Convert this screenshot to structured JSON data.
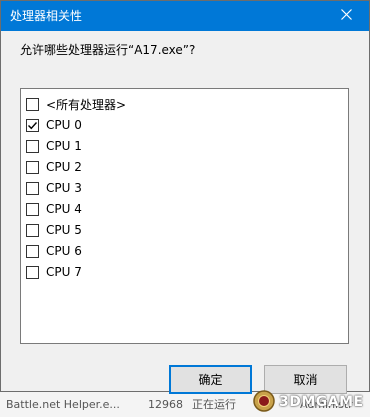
{
  "dialog": {
    "title": "处理器相关性",
    "prompt": "允许哪些处理器运行“A17.exe”?",
    "items": [
      {
        "label": "<所有处理器>",
        "checked": false
      },
      {
        "label": "CPU 0",
        "checked": true
      },
      {
        "label": "CPU 1",
        "checked": false
      },
      {
        "label": "CPU 2",
        "checked": false
      },
      {
        "label": "CPU 3",
        "checked": false
      },
      {
        "label": "CPU 4",
        "checked": false
      },
      {
        "label": "CPU 5",
        "checked": false
      },
      {
        "label": "CPU 6",
        "checked": false
      },
      {
        "label": "CPU 7",
        "checked": false
      }
    ],
    "ok_label": "确定",
    "cancel_label": "取消",
    "close_icon": "close-icon"
  },
  "background": {
    "row_name": "Battle.net Helper.e...",
    "row_pid": "12968",
    "row_status": "正在运行",
    "row_user": "Administr"
  },
  "watermark": {
    "text": "3DMGAME",
    "logo_icon": "3dm-logo-icon"
  },
  "colors": {
    "titlebar": "#0078d7",
    "default_button_border": "#0078d7",
    "check": "#000000"
  }
}
